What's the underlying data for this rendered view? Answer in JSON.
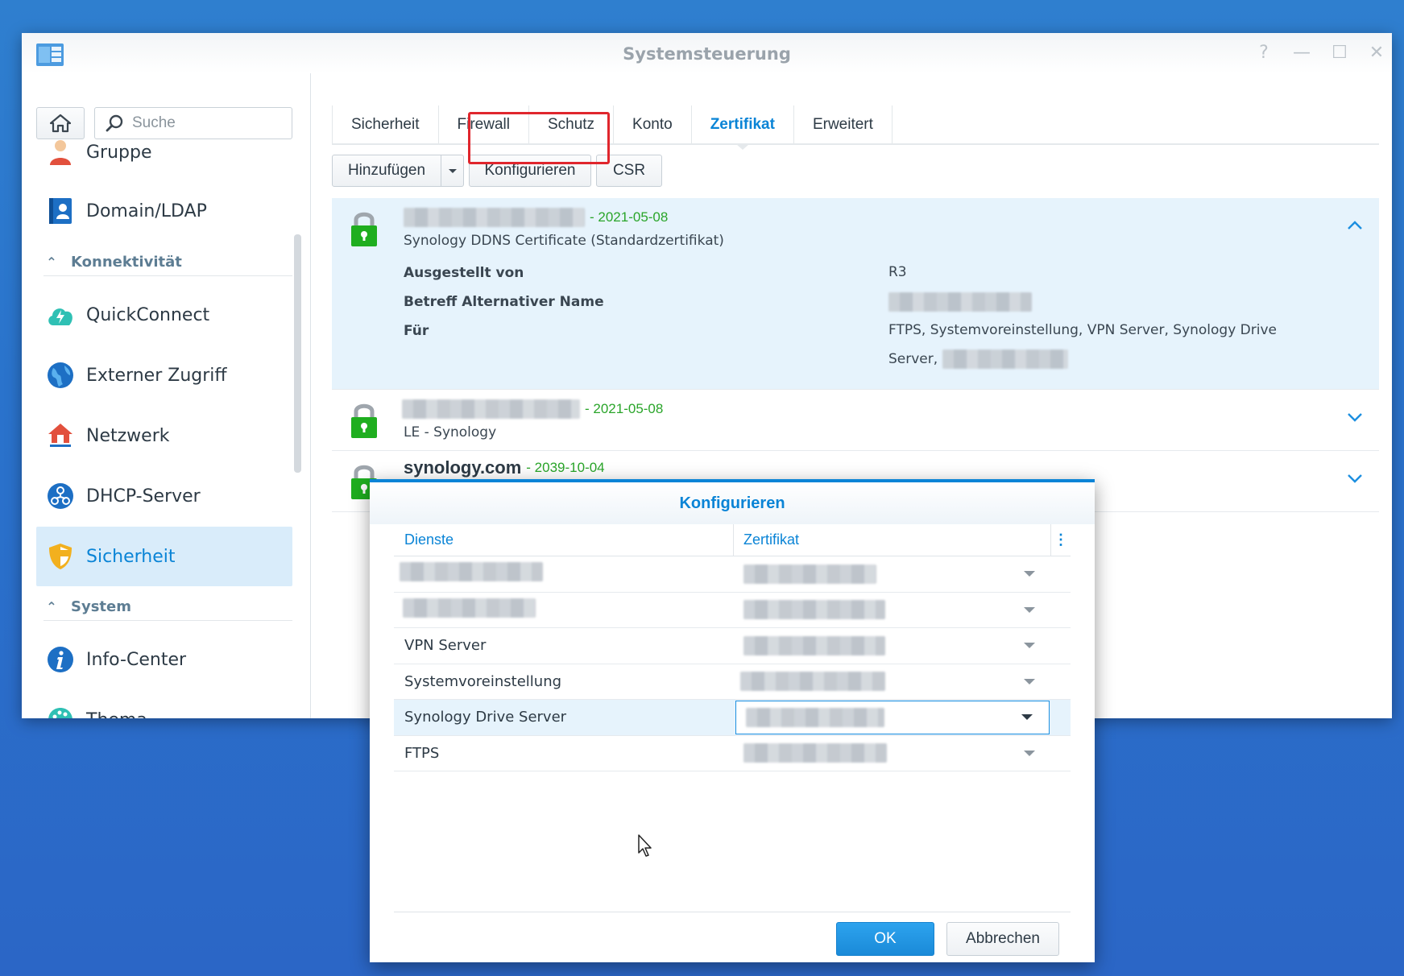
{
  "window": {
    "title": "Systemsteuerung",
    "controls": [
      "?",
      "—",
      "☐",
      "✕"
    ]
  },
  "sidebar": {
    "search_placeholder": "Suche",
    "items": [
      {
        "label": "Gruppe",
        "icon": "group-icon"
      },
      {
        "label": "Domain/LDAP",
        "icon": "domain-ldap-icon"
      },
      {
        "section": "Konnektivität"
      },
      {
        "label": "QuickConnect",
        "icon": "quickconnect-icon"
      },
      {
        "label": "Externer Zugriff",
        "icon": "globe-icon"
      },
      {
        "label": "Netzwerk",
        "icon": "network-house-icon"
      },
      {
        "label": "DHCP-Server",
        "icon": "dhcp-icon"
      },
      {
        "label": "Sicherheit",
        "icon": "shield-icon",
        "active": true
      },
      {
        "section": "System"
      },
      {
        "label": "Info-Center",
        "icon": "info-icon"
      },
      {
        "label": "Thema",
        "icon": "palette-icon"
      }
    ],
    "labels": {
      "gruppe": "Gruppe",
      "domain": "Domain/LDAP",
      "section_konn": "Konnektivität",
      "quickconnect": "QuickConnect",
      "externer": "Externer Zugriff",
      "netzwerk": "Netzwerk",
      "dhcp": "DHCP-Server",
      "sicherheit": "Sicherheit",
      "section_system": "System",
      "infocenter": "Info-Center",
      "thema": "Thema"
    }
  },
  "tabs": {
    "sicherheit": "Sicherheit",
    "firewall": "Firewall",
    "schutz": "Schutz",
    "konto": "Konto",
    "zertifikat": "Zertifikat",
    "erweitert": "Erweitert",
    "active": "Zertifikat"
  },
  "toolbar": {
    "add": "Hinzufügen",
    "configure": "Konfigurieren",
    "csr": "CSR"
  },
  "certificates": {
    "c1": {
      "date": "- 2021-05-08",
      "subtitle": "Synology DDNS Certificate (Standardzertifikat)",
      "issued_by_label": "Ausgestellt von",
      "issued_by_value": "R3",
      "san_label": "Betreff Alternativer Name",
      "for_label": "Für",
      "for_value_line1": "FTPS, Systemvoreinstellung, VPN Server, Synology Drive",
      "for_value_line2": "Server,"
    },
    "c2": {
      "date": "- 2021-05-08",
      "subtitle": "LE - Synology"
    },
    "c3": {
      "name": "synology.com",
      "date": "- 2039-10-04"
    }
  },
  "dialog": {
    "title": "Konfigurieren",
    "col_services": "Dienste",
    "col_certificate": "Zertifikat",
    "rows": {
      "r3": "VPN Server",
      "r4": "Systemvoreinstellung",
      "r5": "Synology Drive Server",
      "r6": "FTPS"
    },
    "ok": "OK",
    "cancel": "Abbrechen"
  },
  "colors": {
    "accent": "#0a84d6",
    "date_green": "#2aa52a",
    "lock_green": "#1fae1f",
    "highlight_red": "#e0262d"
  }
}
